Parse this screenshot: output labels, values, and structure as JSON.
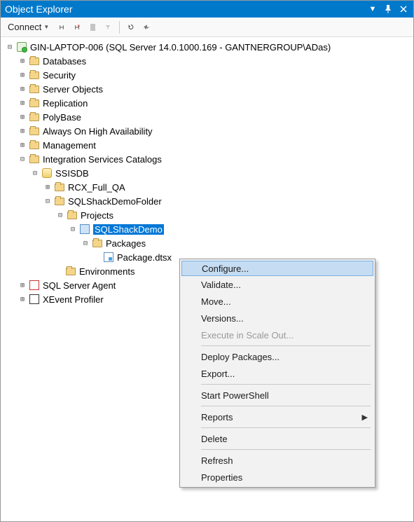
{
  "title": "Object Explorer",
  "toolbar": {
    "connect": "Connect"
  },
  "tree": {
    "server": "GIN-LAPTOP-006 (SQL Server 14.0.1000.169 - GANTNERGROUP\\ADas)",
    "databases": "Databases",
    "security": "Security",
    "server_objects": "Server Objects",
    "replication": "Replication",
    "polybase": "PolyBase",
    "always_on": "Always On High Availability",
    "management": "Management",
    "isc": "Integration Services Catalogs",
    "ssisdb": "SSISDB",
    "rcx": "RCX_Full_QA",
    "demofolder": "SQLShackDemoFolder",
    "projects": "Projects",
    "sqlshackdemo": "SQLShackDemo",
    "packages": "Packages",
    "package_dtsx": "Package.dtsx",
    "environments": "Environments",
    "agent": "SQL Server Agent",
    "xevent": "XEvent Profiler"
  },
  "menu": {
    "configure": "Configure...",
    "validate": "Validate...",
    "move": "Move...",
    "versions": "Versions...",
    "execute_scale_out": "Execute in Scale Out...",
    "deploy": "Deploy Packages...",
    "export": "Export...",
    "start_ps": "Start PowerShell",
    "reports": "Reports",
    "delete": "Delete",
    "refresh": "Refresh",
    "properties": "Properties"
  }
}
